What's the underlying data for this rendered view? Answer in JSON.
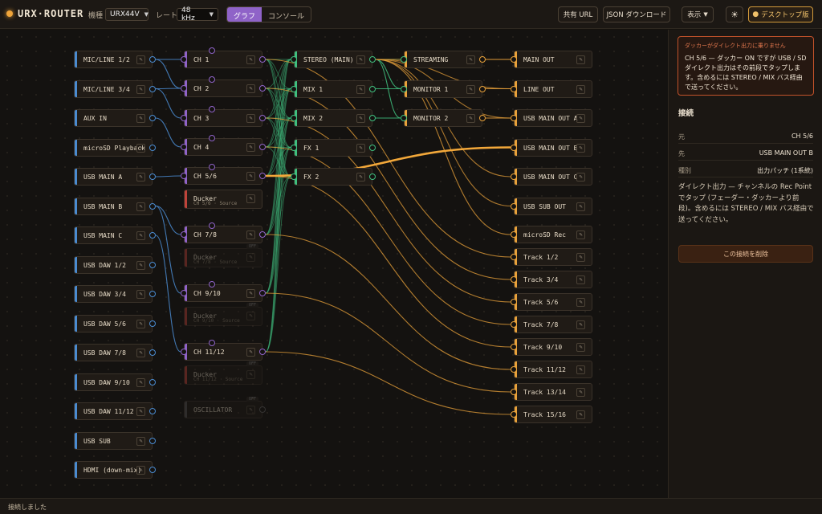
{
  "app": {
    "title": "URX·ROUTER"
  },
  "toolbar": {
    "device_label": "機種",
    "device_value": "URX44V",
    "rate_label": "レート",
    "rate_value": "48 kHz",
    "view_graph": "グラフ",
    "view_console": "コンソール",
    "share_url": "共有 URL",
    "json_download": "JSON ダウンロード",
    "display": "表示",
    "desktop": "デスクトップ版"
  },
  "inputs": [
    {
      "label": "MIC/LINE 1/2"
    },
    {
      "label": "MIC/LINE 3/4"
    },
    {
      "label": "AUX IN"
    },
    {
      "label": "microSD Playback"
    },
    {
      "label": "USB MAIN A"
    },
    {
      "label": "USB MAIN B"
    },
    {
      "label": "USB MAIN C"
    },
    {
      "label": "USB DAW 1/2"
    },
    {
      "label": "USB DAW 3/4"
    },
    {
      "label": "USB DAW 5/6"
    },
    {
      "label": "USB DAW 7/8"
    },
    {
      "label": "USB DAW 9/10"
    },
    {
      "label": "USB DAW 11/12"
    },
    {
      "label": "USB SUB"
    },
    {
      "label": "HDMI (down-mix)"
    }
  ],
  "channels": [
    {
      "label": "CH 1"
    },
    {
      "label": "CH 2"
    },
    {
      "label": "CH 3"
    },
    {
      "label": "CH 4"
    },
    {
      "label": "CH 5/6"
    },
    {
      "label": "CH 7/8"
    },
    {
      "label": "CH 9/10"
    },
    {
      "label": "CH 11/12"
    }
  ],
  "duckers": [
    {
      "label": "Ducker",
      "sub": "CH 5/6 · Source",
      "badge": ""
    },
    {
      "label": "Ducker",
      "sub": "CH 7/8 · Source",
      "badge": "OFF"
    },
    {
      "label": "Ducker",
      "sub": "CH 9/10 · Source",
      "badge": "OFF"
    },
    {
      "label": "Ducker",
      "sub": "CH 11/12 · Source",
      "badge": "OFF"
    }
  ],
  "oscillator": {
    "label": "OSCILLATOR",
    "badge": "OFF"
  },
  "buses": [
    {
      "label": "STEREO (MAIN)"
    },
    {
      "label": "MIX 1"
    },
    {
      "label": "MIX 2"
    },
    {
      "label": "FX 1"
    },
    {
      "label": "FX 2"
    }
  ],
  "monitors": [
    {
      "label": "STREAMING"
    },
    {
      "label": "MONITOR 1"
    },
    {
      "label": "MONITOR 2"
    }
  ],
  "outputs": [
    {
      "label": "MAIN OUT"
    },
    {
      "label": "LINE OUT"
    },
    {
      "label": "USB MAIN OUT A"
    },
    {
      "label": "USB MAIN OUT B"
    },
    {
      "label": "USB MAIN OUT C"
    },
    {
      "label": "USB SUB OUT"
    }
  ],
  "recs": [
    {
      "label": "microSD Rec"
    },
    {
      "label": "Track 1/2"
    },
    {
      "label": "Track 3/4"
    },
    {
      "label": "Track 5/6"
    },
    {
      "label": "Track 7/8"
    },
    {
      "label": "Track 9/10"
    },
    {
      "label": "Track 11/12"
    },
    {
      "label": "Track 13/14"
    },
    {
      "label": "Track 15/16"
    }
  ],
  "panel": {
    "warning_title": "ダッカーがダイレクト出力に乗りません",
    "warning_body": "CH 5/6 — ダッカー ON ですが USB / SD ダイレクト出力はその前段でタップします。含めるには STEREO / MIX バス経由で送ってください。",
    "heading": "接続",
    "rows": [
      {
        "k": "元",
        "v": "CH 5/6"
      },
      {
        "k": "先",
        "v": "USB MAIN OUT B"
      },
      {
        "k": "種別",
        "v": "出力パッチ (1系統)"
      }
    ],
    "description": "ダイレクト出力 — チャンネルの Rec Point でタップ (フェーダー・ダッカーより前段)。含めるには STEREO / MIX バス経由で送ってください。",
    "delete_label": "この接続を削除"
  },
  "status": "接続しました",
  "colors": {
    "accent": "#f0a53a",
    "input": "#4a8bd0",
    "channel": "#8f63c8",
    "bus": "#3fbf7f",
    "output": "#e8a13a",
    "warning": "#c2522a"
  }
}
